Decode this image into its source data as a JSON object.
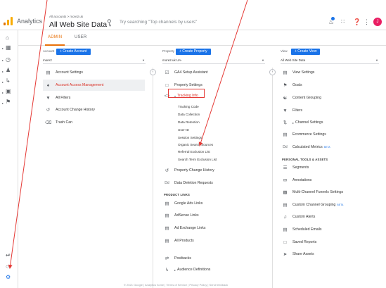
{
  "header": {
    "app_name": "Analytics",
    "breadcrumb": "All accounts > more2.uk",
    "view_name": "All Web Site Data",
    "view_caret": "▾",
    "search_placeholder": "Try searching \"Top channels by users\"",
    "avatar_letter": "J"
  },
  "tabs": [
    {
      "label": "ADMIN"
    },
    {
      "label": "USER"
    }
  ],
  "account": {
    "heading": "Account",
    "create_label": "+ Create Account",
    "selected": "more2",
    "items": [
      {
        "label": "Account Settings"
      },
      {
        "label": "Account Access Management"
      },
      {
        "label": "All Filters"
      },
      {
        "label": "Account Change History"
      },
      {
        "label": "Trash Can"
      }
    ]
  },
  "property": {
    "heading": "Property",
    "create_label": "+ Create Property",
    "selected": "more2.uk UA-",
    "items": [
      {
        "label": "GA4 Setup Assistant"
      },
      {
        "label": "Property Settings"
      },
      {
        "label": "Tracking Info"
      }
    ],
    "tracking_subitems": [
      "Tracking Code",
      "Data Collection",
      "Data Retention",
      "User-ID",
      "Session Settings",
      "Organic Search Sources",
      "Referral Exclusion List",
      "Search Term Exclusion List"
    ],
    "items_after": [
      {
        "label": "Property Change History"
      },
      {
        "label": "Data Deletion Requests"
      }
    ],
    "product_links_label": "PRODUCT LINKS",
    "product_links": [
      {
        "label": "Google Ads Links"
      },
      {
        "label": "AdSense Links"
      },
      {
        "label": "Ad Exchange Links"
      },
      {
        "label": "All Products"
      }
    ],
    "more_items": [
      {
        "label": "Postbacks"
      },
      {
        "label": "Audience Definitions"
      }
    ]
  },
  "view": {
    "heading": "View",
    "create_label": "+ Create View",
    "selected": "All Web Site Data",
    "items": [
      {
        "label": "View Settings"
      },
      {
        "label": "Goals"
      },
      {
        "label": "Content Grouping"
      },
      {
        "label": "Filters"
      },
      {
        "label": "Channel Settings"
      },
      {
        "label": "Ecommerce Settings"
      },
      {
        "label": "Calculated Metrics",
        "badge": "BETA"
      }
    ],
    "personal_label": "PERSONAL TOOLS & ASSETS",
    "personal_items": [
      {
        "label": "Segments"
      },
      {
        "label": "Annotations"
      },
      {
        "label": "Multi-Channel Funnels Settings"
      },
      {
        "label": "Custom Channel Grouping",
        "badge": "BETA"
      },
      {
        "label": "Custom Alerts"
      },
      {
        "label": "Scheduled Emails"
      },
      {
        "label": "Saved Reports"
      },
      {
        "label": "Share Assets"
      }
    ]
  },
  "colors": {
    "accent": "#1a73e8",
    "admin_tab": "#e8710a",
    "highlight_text": "#d93025",
    "annotation_red": "#e53935"
  }
}
